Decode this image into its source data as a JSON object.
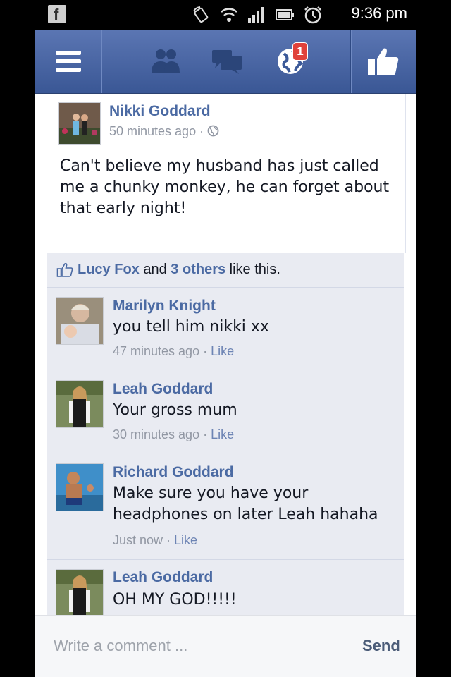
{
  "status_bar": {
    "time": "9:36 pm",
    "icons": [
      "facebook-icon",
      "rotate-icon",
      "wifi-icon",
      "signal-icon",
      "battery-icon",
      "alarm-icon"
    ]
  },
  "nav": {
    "icons": [
      "menu-icon",
      "friend-requests-icon",
      "messages-icon",
      "notifications-globe-icon",
      "like-thumb-icon"
    ],
    "notification_count": "1"
  },
  "post": {
    "author": "Nikki Goddard",
    "time": "50 minutes ago",
    "privacy_icon": "globe-icon",
    "text": "Can't believe my husband has just called me a chunky monkey, he can forget about that early night!"
  },
  "likes": {
    "first": "Lucy Fox",
    "and": "and",
    "others": "3 others",
    "suffix": "like this."
  },
  "comments": [
    {
      "author": "Marilyn Knight",
      "text": "you tell him nikki xx",
      "time": "47 minutes ago",
      "like": "Like"
    },
    {
      "author": "Leah Goddard",
      "text": "Your gross mum",
      "time": "30 minutes ago",
      "like": "Like"
    },
    {
      "author": "Richard Goddard",
      "text": "Make sure you have your headphones on later Leah hahaha",
      "time": "Just now",
      "like": "Like"
    },
    {
      "author": "Leah Goddard",
      "text": "OH MY GOD!!!!!",
      "time": "",
      "like": ""
    }
  ],
  "composer": {
    "placeholder": "Write a comment ...",
    "send": "Send"
  },
  "colors": {
    "nav_blue": "#3b5998",
    "link_blue": "#4b6aa3",
    "comment_bg": "#e9ebf2",
    "badge_red": "#e0413a"
  }
}
